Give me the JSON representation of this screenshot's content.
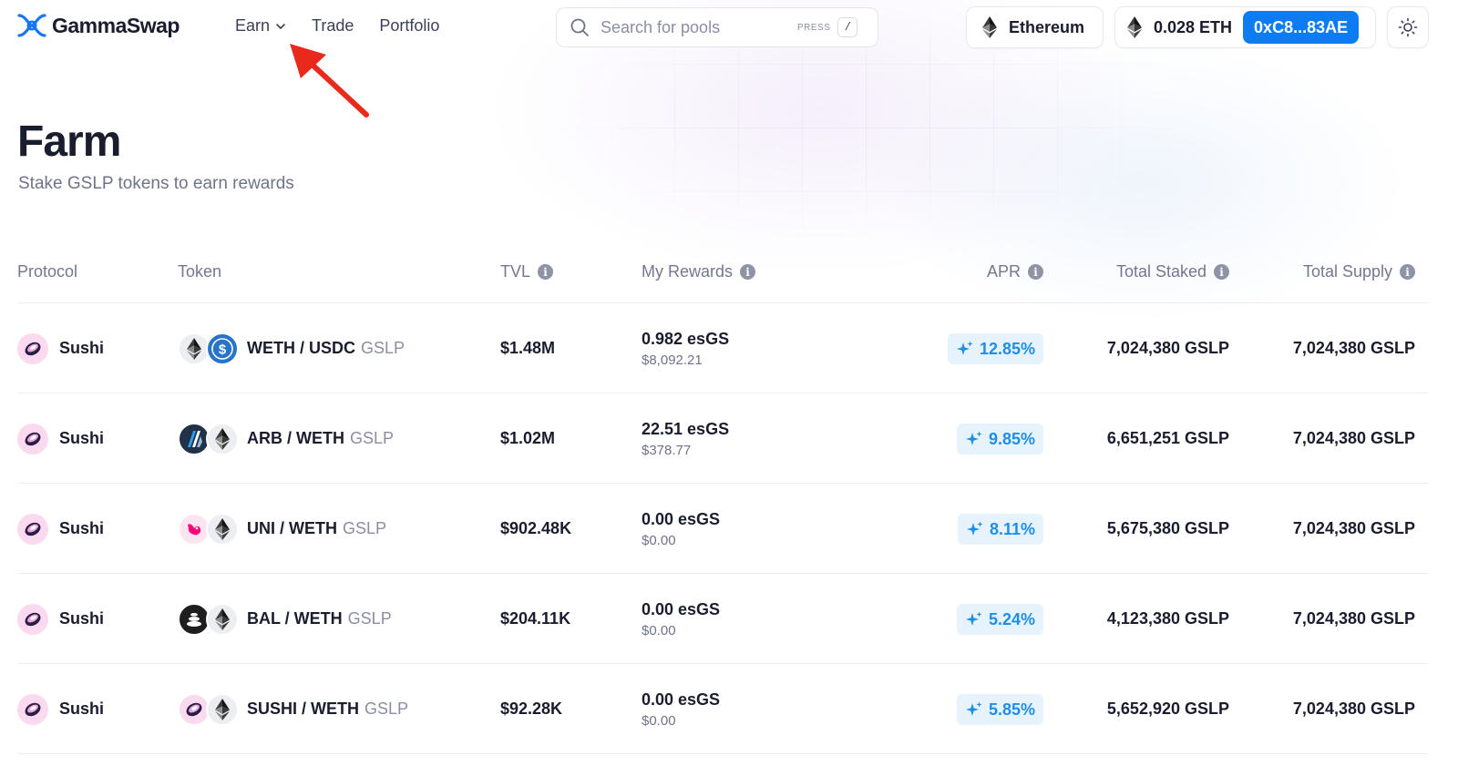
{
  "brand": {
    "name": "GammaSwap"
  },
  "nav": [
    {
      "label": "Earn",
      "has_dropdown": true
    },
    {
      "label": "Trade"
    },
    {
      "label": "Portfolio"
    }
  ],
  "search": {
    "placeholder": "Search for pools",
    "hint_label": "PRESS",
    "hint_key": "/"
  },
  "network": {
    "label": "Ethereum",
    "icon": "ethereum-icon"
  },
  "wallet": {
    "balance": "0.028 ETH",
    "address": "0xC8...83AE"
  },
  "theme_toggle": {
    "icon": "sun-icon"
  },
  "page": {
    "title": "Farm",
    "subtitle": "Stake GSLP tokens to earn rewards"
  },
  "annotation": {
    "type": "arrow",
    "color": "#e8291c",
    "points_to": "Earn"
  },
  "table": {
    "columns": {
      "protocol": "Protocol",
      "token": "Token",
      "tvl": "TVL",
      "rewards": "My Rewards",
      "apr": "APR",
      "staked": "Total Staked",
      "supply": "Total Supply"
    },
    "rows": [
      {
        "protocol": "Sushi",
        "pair": "WETH / USDC",
        "suffix": "GSLP",
        "coins": [
          "eth",
          "usdc"
        ],
        "tvl": "$1.48M",
        "rewards_amount": "0.982 esGS",
        "rewards_usd": "$8,092.21",
        "apr": "12.85%",
        "staked": "7,024,380 GSLP",
        "supply": "7,024,380 GSLP"
      },
      {
        "protocol": "Sushi",
        "pair": "ARB / WETH",
        "suffix": "GSLP",
        "coins": [
          "arb",
          "eth"
        ],
        "tvl": "$1.02M",
        "rewards_amount": "22.51 esGS",
        "rewards_usd": "$378.77",
        "apr": "9.85%",
        "staked": "6,651,251 GSLP",
        "supply": "7,024,380 GSLP"
      },
      {
        "protocol": "Sushi",
        "pair": "UNI / WETH",
        "suffix": "GSLP",
        "coins": [
          "uni",
          "eth"
        ],
        "tvl": "$902.48K",
        "rewards_amount": "0.00 esGS",
        "rewards_usd": "$0.00",
        "apr": "8.11%",
        "staked": "5,675,380 GSLP",
        "supply": "7,024,380 GSLP"
      },
      {
        "protocol": "Sushi",
        "pair": "BAL / WETH",
        "suffix": "GSLP",
        "coins": [
          "bal",
          "eth"
        ],
        "tvl": "$204.11K",
        "rewards_amount": "0.00 esGS",
        "rewards_usd": "$0.00",
        "apr": "5.24%",
        "staked": "4,123,380 GSLP",
        "supply": "7,024,380 GSLP"
      },
      {
        "protocol": "Sushi",
        "pair": "SUSHI / WETH",
        "suffix": "GSLP",
        "coins": [
          "sushi",
          "eth"
        ],
        "tvl": "$92.28K",
        "rewards_amount": "0.00 esGS",
        "rewards_usd": "$0.00",
        "apr": "5.85%",
        "staked": "5,652,920 GSLP",
        "supply": "7,024,380 GSLP"
      }
    ]
  },
  "colors": {
    "accent": "#0d7cf2",
    "apr_bg": "#e6f3fd",
    "apr_text": "#1f8ee6",
    "text": "#1a1d2e",
    "muted": "#737790"
  }
}
